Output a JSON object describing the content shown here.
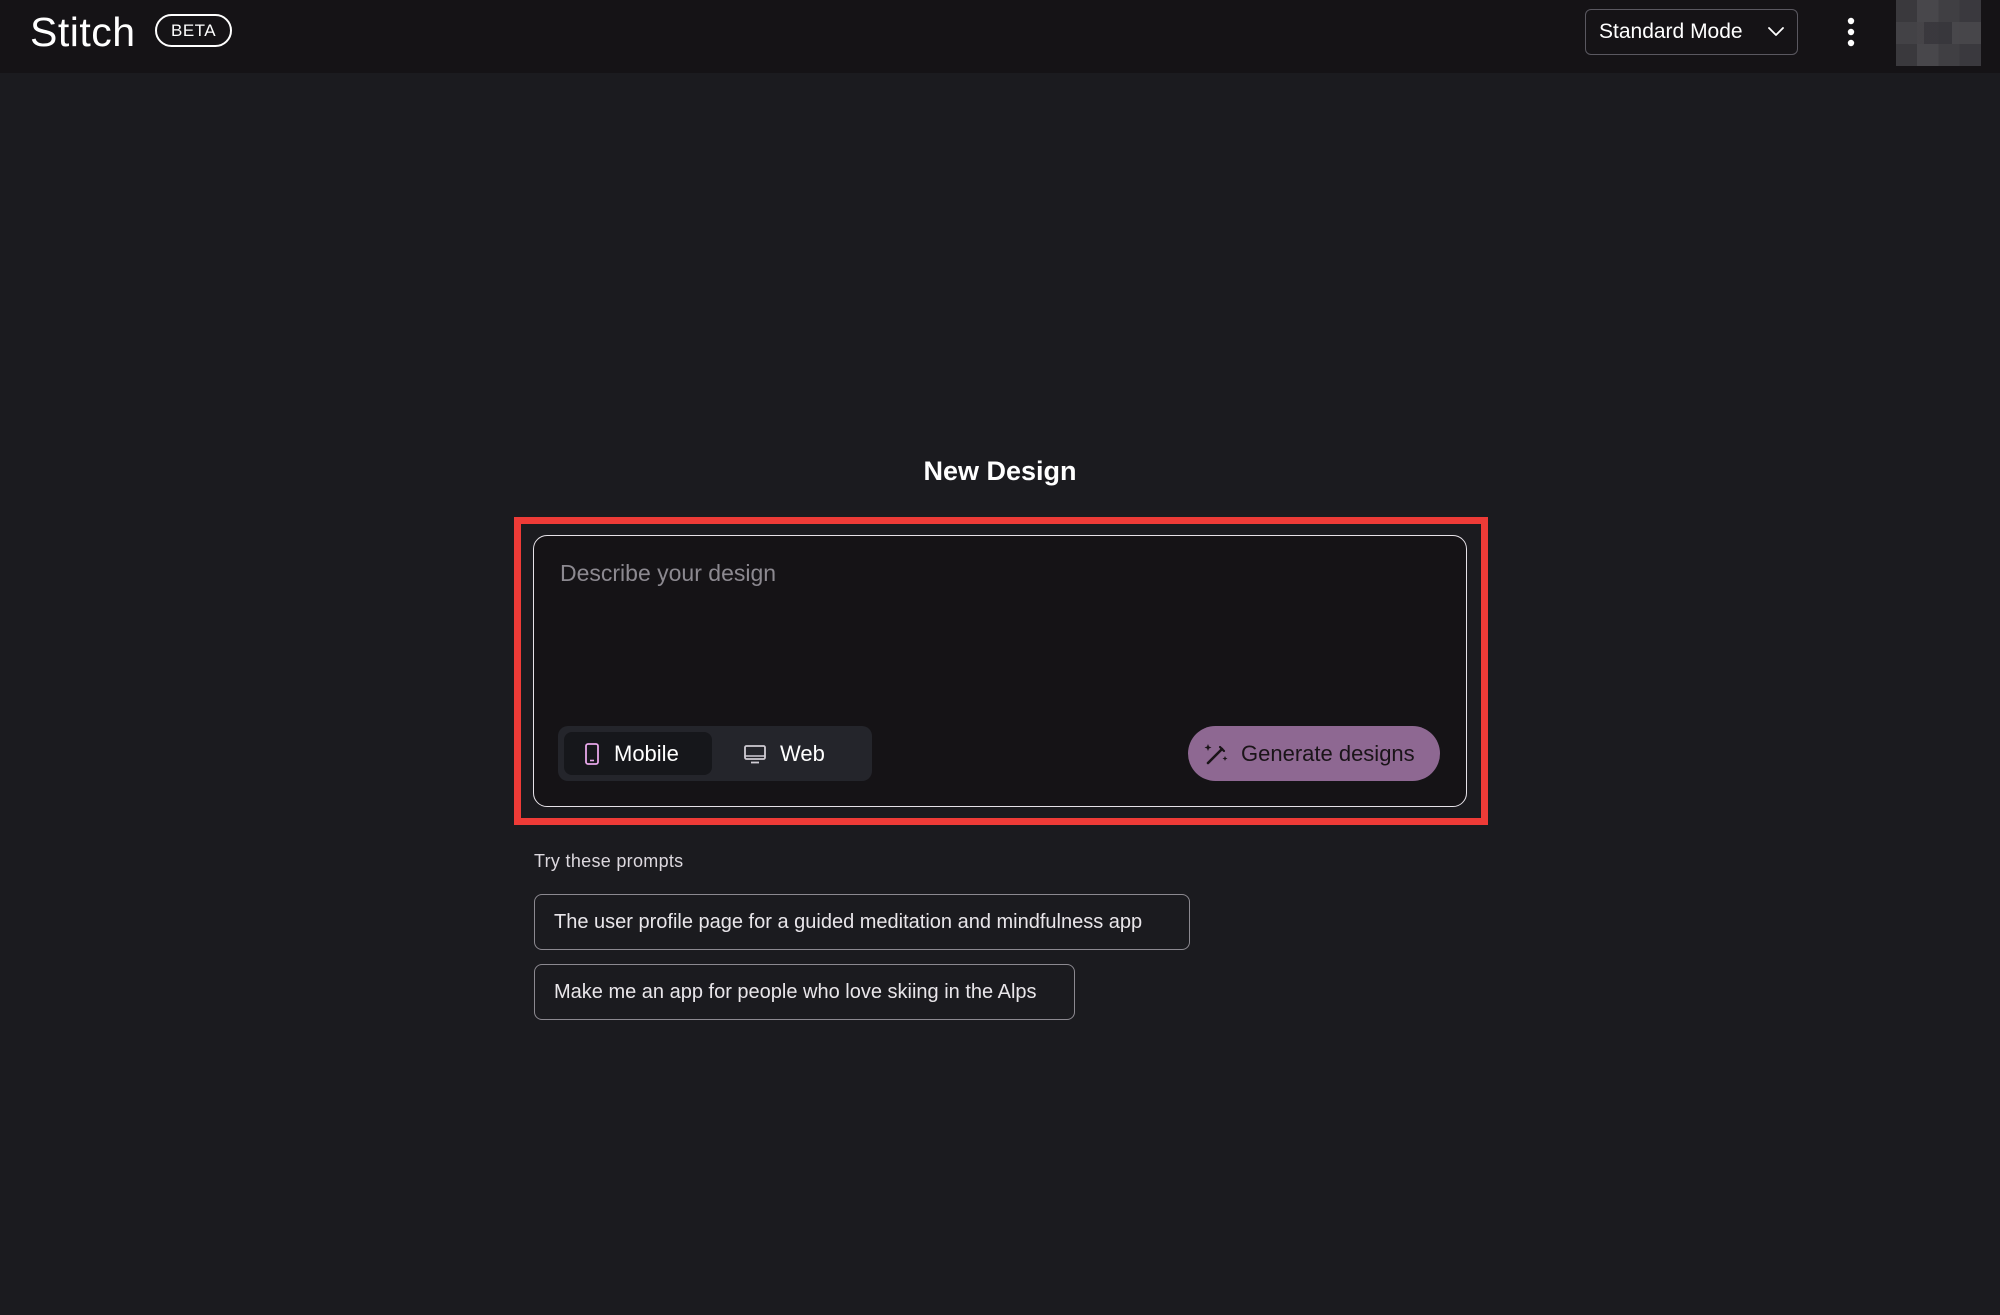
{
  "app": {
    "name": "Stitch",
    "badge": "BETA"
  },
  "header": {
    "mode_select": {
      "selected": "Standard Mode",
      "icon": "chevron-down-icon"
    },
    "more_icon": "more-vert-icon",
    "avatar_icon": "user-avatar"
  },
  "main": {
    "title": "New Design",
    "prompt": {
      "value": "",
      "placeholder": "Describe your design"
    },
    "device_toggle": {
      "options": [
        {
          "label": "Mobile",
          "icon": "smartphone-icon",
          "selected": true
        },
        {
          "label": "Web",
          "icon": "monitor-icon",
          "selected": false
        }
      ]
    },
    "generate_button": {
      "label": "Generate designs",
      "icon": "magic-wand-icon"
    },
    "suggestions": {
      "heading": "Try these prompts",
      "items": [
        "The user profile page for a guided meditation and mindfulness app",
        "Make me an app for people who love skiing in the Alps"
      ]
    }
  },
  "colors": {
    "background": "#1b1b1f",
    "topbar": "#151316",
    "accent": "#8e6892",
    "highlight": "#ee3b37"
  }
}
